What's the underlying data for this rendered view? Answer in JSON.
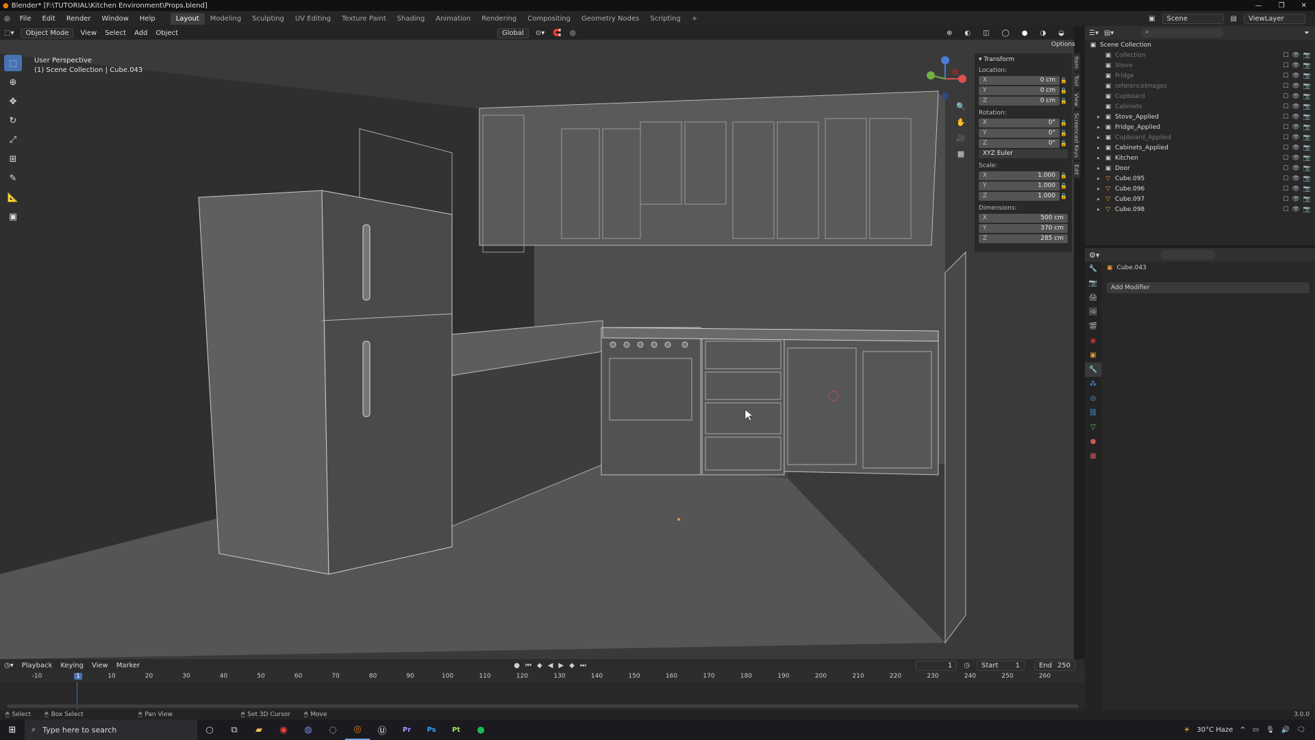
{
  "window": {
    "title": "Blender* [F:\\TUTORIAL\\Kitchen Environment\\Props.blend]",
    "controls": [
      "—",
      "❐",
      "✕"
    ]
  },
  "menus": [
    "File",
    "Edit",
    "Render",
    "Window",
    "Help"
  ],
  "workspaces": [
    "Layout",
    "Modeling",
    "Sculpting",
    "UV Editing",
    "Texture Paint",
    "Shading",
    "Animation",
    "Rendering",
    "Compositing",
    "Geometry Nodes",
    "Scripting",
    "+"
  ],
  "scene": {
    "name": "Scene",
    "view_layer": "ViewLayer"
  },
  "viewport_header": {
    "mode": "Object Mode",
    "view": "View",
    "select": "Select",
    "add": "Add",
    "object": "Object",
    "orientation": "Global",
    "options": "Options"
  },
  "viewport": {
    "perspective": "User Perspective",
    "context": "(1) Scene Collection | Cube.043"
  },
  "tools": [
    "select-box",
    "cursor",
    "move",
    "rotate",
    "scale",
    "transform",
    "annotate",
    "measure",
    "add-cube"
  ],
  "npanel": {
    "title": "Transform",
    "location_label": "Location:",
    "location": [
      {
        "axis": "X",
        "value": "0 cm"
      },
      {
        "axis": "Y",
        "value": "0 cm"
      },
      {
        "axis": "Z",
        "value": "0 cm"
      }
    ],
    "rotation_label": "Rotation:",
    "rotation": [
      {
        "axis": "X",
        "value": "0°"
      },
      {
        "axis": "Y",
        "value": "0°"
      },
      {
        "axis": "Z",
        "value": "0°"
      }
    ],
    "rotation_mode": "XYZ Euler",
    "scale_label": "Scale:",
    "scale": [
      {
        "axis": "X",
        "value": "1.000"
      },
      {
        "axis": "Y",
        "value": "1.000"
      },
      {
        "axis": "Z",
        "value": "1.000"
      }
    ],
    "dimensions_label": "Dimensions:",
    "dimensions": [
      {
        "axis": "X",
        "value": "500 cm"
      },
      {
        "axis": "Y",
        "value": "370 cm"
      },
      {
        "axis": "Z",
        "value": "285 cm"
      }
    ],
    "tabs": [
      "Item",
      "Tool",
      "View",
      "Screencast Keys",
      "Edit"
    ]
  },
  "outliner": {
    "root": "Scene Collection",
    "items": [
      {
        "name": "Collection",
        "dim": true
      },
      {
        "name": "Stove",
        "dim": true
      },
      {
        "name": "Fridge",
        "dim": true
      },
      {
        "name": "referenceImages",
        "dim": true
      },
      {
        "name": "Cupboard",
        "dim": true
      },
      {
        "name": "Cabinets",
        "dim": true
      },
      {
        "name": "Stove_Applied",
        "dim": false
      },
      {
        "name": "Fridge_Applied",
        "dim": false
      },
      {
        "name": "Cupboard_Applied",
        "dim": true
      },
      {
        "name": "Cabinets_Applied",
        "dim": false
      },
      {
        "name": "Kitchen",
        "dim": false
      },
      {
        "name": "Door",
        "dim": false
      },
      {
        "name": "Cube.095",
        "dim": false
      },
      {
        "name": "Cube.096",
        "dim": false
      },
      {
        "name": "Cube.097",
        "dim": false
      },
      {
        "name": "Cube.098",
        "dim": false
      }
    ]
  },
  "properties": {
    "object": "Cube.043",
    "add_modifier": "Add Modifier"
  },
  "timeline": {
    "menus": [
      "Playback",
      "Keying",
      "View",
      "Marker"
    ],
    "current_frame": "1",
    "start_label": "Start",
    "start": "1",
    "end_label": "End",
    "end": "250",
    "ticks": [
      "-10",
      "1",
      "10",
      "20",
      "30",
      "40",
      "50",
      "60",
      "70",
      "80",
      "90",
      "100",
      "110",
      "120",
      "130",
      "140",
      "150",
      "160",
      "170",
      "180",
      "190",
      "200",
      "210",
      "220",
      "230",
      "240",
      "250",
      "260"
    ]
  },
  "statusbar": {
    "select": "Select",
    "box_select": "Box Select",
    "pan_view": "Pan View",
    "set_cursor": "Set 3D Cursor",
    "move": "Move",
    "version": "3.0.0"
  },
  "taskbar": {
    "search_placeholder": "Type here to search",
    "weather": "30°C Haze",
    "apps": [
      "Cortana",
      "Task View",
      "File Explorer",
      "Chrome",
      "Discord",
      "Steam",
      "Blender",
      "Unreal",
      "Premiere",
      "Photoshop",
      "Painter",
      "Spotify"
    ]
  },
  "colors": {
    "accent": "#4772b3",
    "object_orange": "#e69a3a",
    "timeline_frame": "#4772b3"
  }
}
